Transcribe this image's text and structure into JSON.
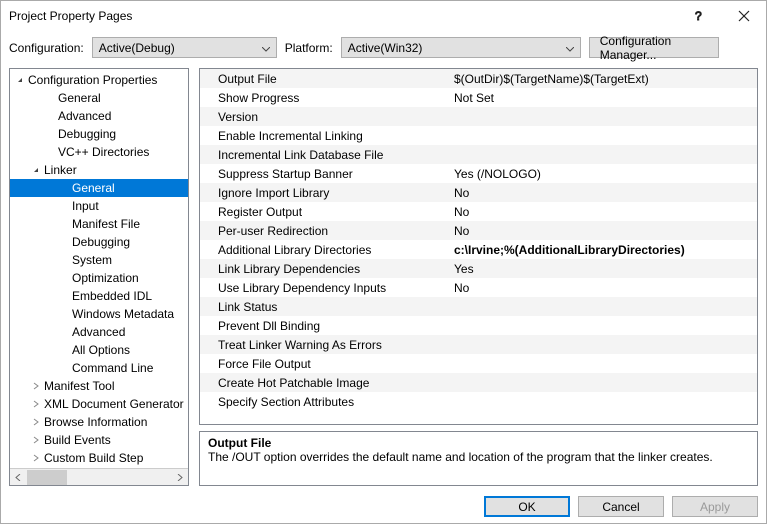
{
  "window": {
    "title": "Project Property Pages"
  },
  "toolbar": {
    "config_label": "Configuration:",
    "config_value": "Active(Debug)",
    "platform_label": "Platform:",
    "platform_value": "Active(Win32)",
    "config_manager": "Configuration Manager..."
  },
  "tree": {
    "root": "Configuration Properties",
    "items": [
      "General",
      "Advanced",
      "Debugging",
      "VC++ Directories"
    ],
    "linker": "Linker",
    "linker_items": [
      "General",
      "Input",
      "Manifest File",
      "Debugging",
      "System",
      "Optimization",
      "Embedded IDL",
      "Windows Metadata",
      "Advanced",
      "All Options",
      "Command Line"
    ],
    "after": [
      "Manifest Tool",
      "XML Document Generator",
      "Browse Information",
      "Build Events",
      "Custom Build Step"
    ],
    "selected": "General"
  },
  "properties": [
    {
      "name": "Output File",
      "value": "$(OutDir)$(TargetName)$(TargetExt)"
    },
    {
      "name": "Show Progress",
      "value": "Not Set"
    },
    {
      "name": "Version",
      "value": ""
    },
    {
      "name": "Enable Incremental Linking",
      "value": ""
    },
    {
      "name": "Incremental Link Database File",
      "value": ""
    },
    {
      "name": "Suppress Startup Banner",
      "value": "Yes (/NOLOGO)"
    },
    {
      "name": "Ignore Import Library",
      "value": "No"
    },
    {
      "name": "Register Output",
      "value": "No"
    },
    {
      "name": "Per-user Redirection",
      "value": "No"
    },
    {
      "name": "Additional Library Directories",
      "value": "c:\\Irvine;%(AdditionalLibraryDirectories)",
      "bold": true
    },
    {
      "name": "Link Library Dependencies",
      "value": "Yes"
    },
    {
      "name": "Use Library Dependency Inputs",
      "value": "No"
    },
    {
      "name": "Link Status",
      "value": ""
    },
    {
      "name": "Prevent Dll Binding",
      "value": ""
    },
    {
      "name": "Treat Linker Warning As Errors",
      "value": ""
    },
    {
      "name": "Force File Output",
      "value": ""
    },
    {
      "name": "Create Hot Patchable Image",
      "value": ""
    },
    {
      "name": "Specify Section Attributes",
      "value": ""
    }
  ],
  "help": {
    "title": "Output File",
    "body": "The /OUT option overrides the default name and location of the program that the linker creates."
  },
  "footer": {
    "ok": "OK",
    "cancel": "Cancel",
    "apply": "Apply"
  }
}
